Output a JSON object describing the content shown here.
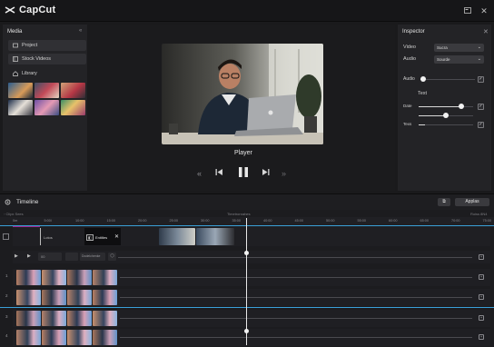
{
  "app": {
    "title": "CapCut"
  },
  "media": {
    "title": "Media",
    "buttons": [
      {
        "label": "Project"
      },
      {
        "label": "Stock Videos"
      },
      {
        "label": "Library"
      }
    ]
  },
  "player": {
    "label": "Player"
  },
  "inspector": {
    "title": "Inspector",
    "video_label": "Video",
    "video_value": "Sucra",
    "audio_label": "Audio",
    "audio_value": "Sourde",
    "audio_slider_label": "Audio",
    "text_heading": "Text",
    "slider1_label": "Date",
    "slider2_label": "Texs",
    "audio_level": 0.05,
    "date_level": 0.78,
    "second_level": 0.5,
    "texs_level": 0.12
  },
  "timeline": {
    "title": "Timeline",
    "apply_label": "Applas",
    "left_hint": "Clipx Sees",
    "center_hint": "Timetronrahes",
    "right_hint": "Roiss 8N4",
    "ruler": [
      "0m",
      "5:00l",
      "10:00",
      "15:00",
      "20:00",
      "25:00",
      "30:00",
      "35:00",
      "40:00",
      "45:00",
      "50:00",
      "55:00",
      "60:00",
      "65:00",
      "70:00",
      "75:00"
    ],
    "clip_label": "Lotos",
    "text_clip_label": "Entitles",
    "track_numbers": [
      "1",
      "2",
      "3",
      "4"
    ],
    "ctrl_field": "Dodelchenke",
    "ctrl_small": "00"
  },
  "colors": {
    "accent": "#3aa0d8",
    "playhead": "#e8e8e8",
    "clip_magenta": "#a0208a"
  }
}
